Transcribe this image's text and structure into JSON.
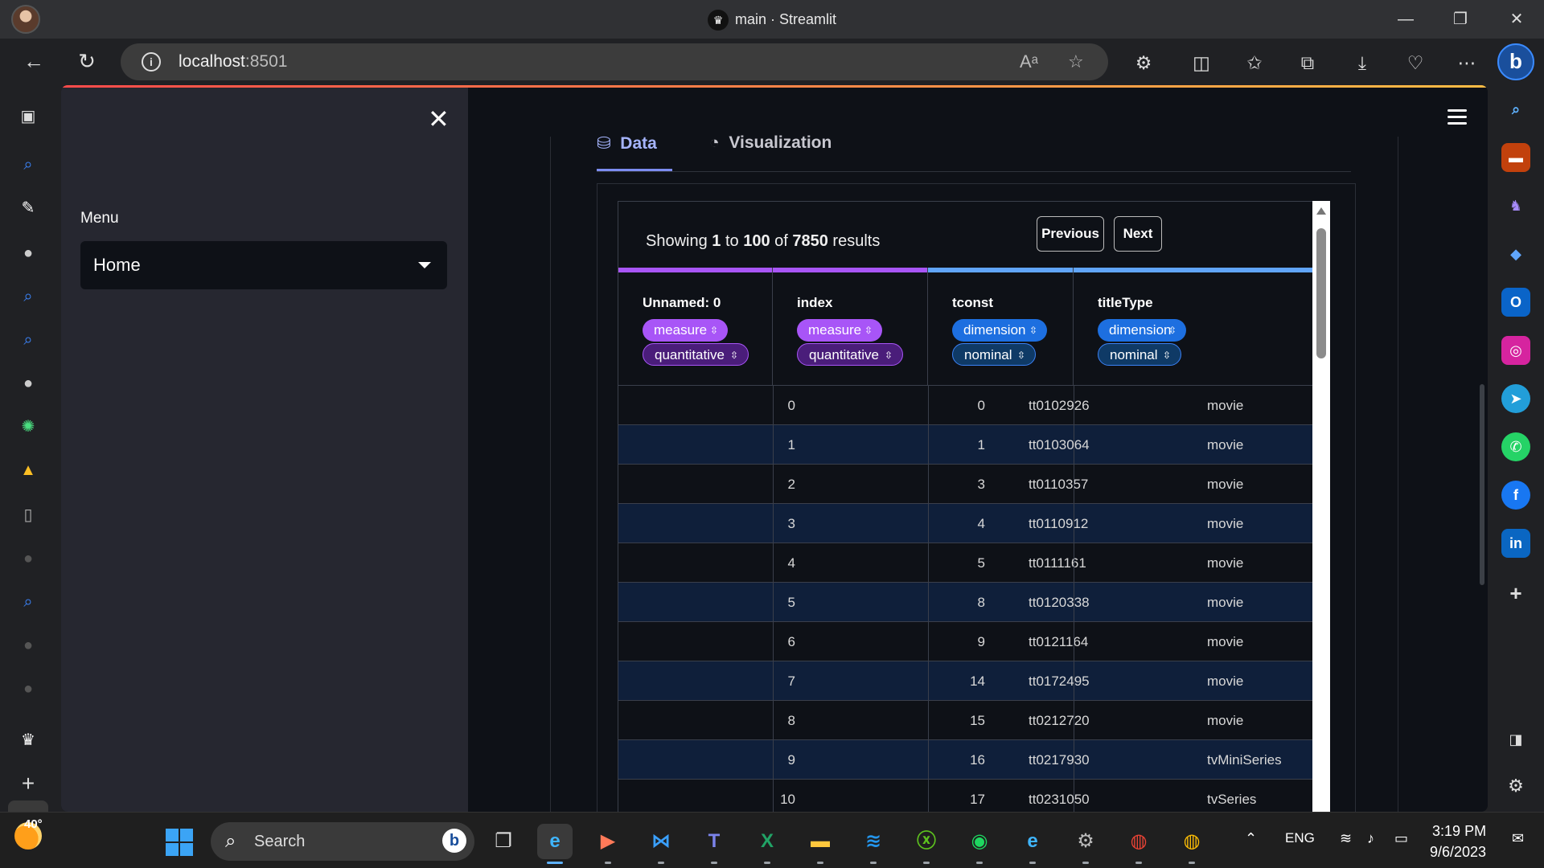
{
  "window": {
    "title": "main · Streamlit",
    "controls": [
      "minimize",
      "restore",
      "close"
    ]
  },
  "browser": {
    "url_host": "localhost",
    "url_port": ":8501",
    "nav": [
      "back-icon",
      "refresh-icon"
    ],
    "toolbar_icons": [
      "read-aloud-icon",
      "favorite-star-icon",
      "extensions-icon",
      "split-screen-icon",
      "favorites-icon",
      "collections-icon",
      "downloads-icon",
      "performance-icon",
      "more-icon",
      "bing-copilot-icon"
    ]
  },
  "sidebar": {
    "menu_label": "Menu",
    "selected": "Home"
  },
  "tabs": [
    {
      "label": "Data",
      "active": true
    },
    {
      "label": "Visualization",
      "active": false
    }
  ],
  "table": {
    "showing_prefix": "Showing ",
    "from": "1",
    "to_word": " to ",
    "to": "100",
    "of_word": " of ",
    "total": "7850",
    "suffix": " results",
    "prev_label": "Previous",
    "next_label": "Next",
    "columns": [
      {
        "name": "Unnamed: 0",
        "role": "measure",
        "type": "quantitative"
      },
      {
        "name": "index",
        "role": "measure",
        "type": "quantitative"
      },
      {
        "name": "tconst",
        "role": "dimension",
        "type": "nominal"
      },
      {
        "name": "titleType",
        "role": "dimension",
        "type": "nominal"
      }
    ],
    "rows": [
      [
        "0",
        "0",
        "tt0102926",
        "movie"
      ],
      [
        "1",
        "1",
        "tt0103064",
        "movie"
      ],
      [
        "2",
        "3",
        "tt0110357",
        "movie"
      ],
      [
        "3",
        "4",
        "tt0110912",
        "movie"
      ],
      [
        "4",
        "5",
        "tt0111161",
        "movie"
      ],
      [
        "5",
        "8",
        "tt0120338",
        "movie"
      ],
      [
        "6",
        "9",
        "tt0121164",
        "movie"
      ],
      [
        "7",
        "14",
        "tt0172495",
        "movie"
      ],
      [
        "8",
        "15",
        "tt0212720",
        "movie"
      ],
      [
        "9",
        "16",
        "tt0217930",
        "tvMiniSeries"
      ],
      [
        "10",
        "17",
        "tt0231050",
        "tvSeries"
      ]
    ]
  },
  "taskbar": {
    "temperature": "40°",
    "search_label": "Search",
    "language": "ENG",
    "time": "3:19 PM",
    "date": "9/6/2023"
  },
  "colors": {
    "measure": "#a855f7",
    "dimension": "#60a5fa",
    "accent": "#ff4b4b"
  }
}
